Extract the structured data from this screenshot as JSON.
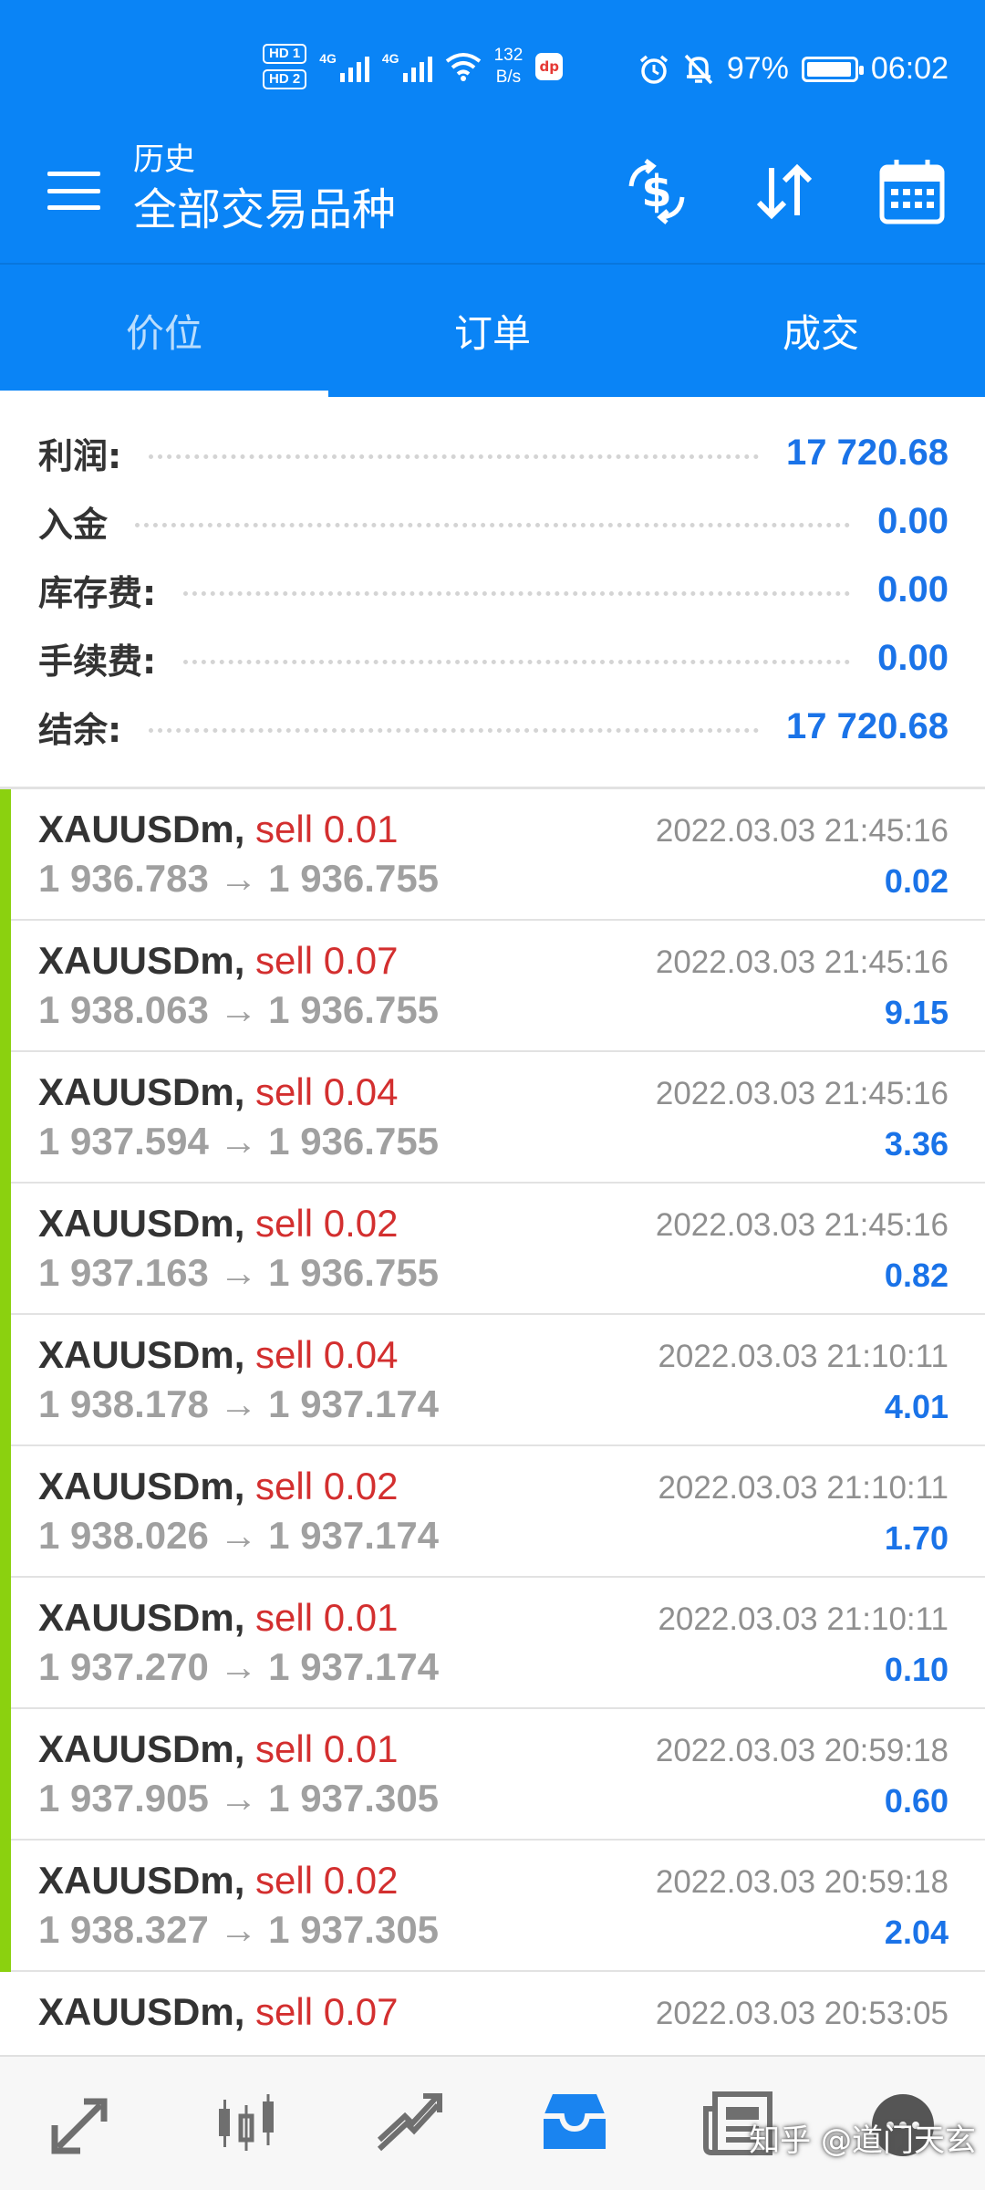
{
  "status_bar": {
    "sim1": "HD 1",
    "sim2": "HD 2",
    "network_1": "4G",
    "network_2": "4G",
    "speed_value": "132",
    "speed_unit": "B/s",
    "app_badge": "dp",
    "battery_percent": "97%",
    "battery_level": 0.97,
    "time": "06:02"
  },
  "app_bar": {
    "subtitle": "历史",
    "title": "全部交易品种",
    "icons": [
      "menu-icon",
      "currency-exchange-icon",
      "sort-icon",
      "calendar-icon"
    ]
  },
  "tabs": [
    {
      "label": "价位",
      "active": true
    },
    {
      "label": "订单",
      "active": false
    },
    {
      "label": "成交",
      "active": false
    }
  ],
  "summary": [
    {
      "label": "利润:",
      "value": "17 720.68"
    },
    {
      "label": "入金",
      "value": "0.00"
    },
    {
      "label": "库存费:",
      "value": "0.00"
    },
    {
      "label": "手续费:",
      "value": "0.00"
    },
    {
      "label": "结余:",
      "value": "17 720.68"
    }
  ],
  "deals": [
    {
      "symbol": "XAUUSDm,",
      "side": "sell 0.01",
      "prices": "1 936.783 → 1 936.755",
      "time": "2022.03.03 21:45:16",
      "profit": "0.02"
    },
    {
      "symbol": "XAUUSDm,",
      "side": "sell 0.07",
      "prices": "1 938.063 → 1 936.755",
      "time": "2022.03.03 21:45:16",
      "profit": "9.15"
    },
    {
      "symbol": "XAUUSDm,",
      "side": "sell 0.04",
      "prices": "1 937.594 → 1 936.755",
      "time": "2022.03.03 21:45:16",
      "profit": "3.36"
    },
    {
      "symbol": "XAUUSDm,",
      "side": "sell 0.02",
      "prices": "1 937.163 → 1 936.755",
      "time": "2022.03.03 21:45:16",
      "profit": "0.82"
    },
    {
      "symbol": "XAUUSDm,",
      "side": "sell 0.04",
      "prices": "1 938.178 → 1 937.174",
      "time": "2022.03.03 21:10:11",
      "profit": "4.01"
    },
    {
      "symbol": "XAUUSDm,",
      "side": "sell 0.02",
      "prices": "1 938.026 → 1 937.174",
      "time": "2022.03.03 21:10:11",
      "profit": "1.70"
    },
    {
      "symbol": "XAUUSDm,",
      "side": "sell 0.01",
      "prices": "1 937.270 → 1 937.174",
      "time": "2022.03.03 21:10:11",
      "profit": "0.10"
    },
    {
      "symbol": "XAUUSDm,",
      "side": "sell 0.01",
      "prices": "1 937.905 → 1 937.305",
      "time": "2022.03.03 20:59:18",
      "profit": "0.60"
    },
    {
      "symbol": "XAUUSDm,",
      "side": "sell 0.02",
      "prices": "1 938.327 → 1 937.305",
      "time": "2022.03.03 20:59:18",
      "profit": "2.04"
    },
    {
      "symbol": "XAUUSDm,",
      "side": "sell 0.07",
      "prices": "",
      "time": "2022.03.03 20:53:05",
      "profit": "",
      "negative": true,
      "partially_visible": true
    }
  ],
  "bottom_nav": [
    {
      "name": "quotes-icon",
      "active": false
    },
    {
      "name": "chart-icon",
      "active": false
    },
    {
      "name": "trade-icon",
      "active": false
    },
    {
      "name": "history-icon",
      "active": true
    },
    {
      "name": "news-icon",
      "active": false
    },
    {
      "name": "chat-icon",
      "active": false
    }
  ],
  "watermark": "知乎 @道门天玄",
  "colors": {
    "primary": "#0a84f6",
    "profit_blue": "#1a73e8",
    "sell_red": "#d32f2f",
    "stripe_green": "#8bd10f",
    "muted_gray": "#a0a0a0"
  }
}
